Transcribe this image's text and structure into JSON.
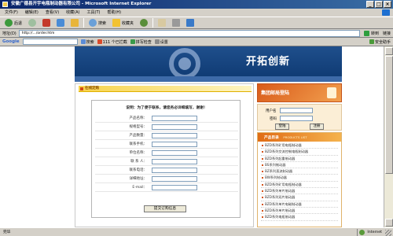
{
  "window": {
    "title": "安徽广德县开宇电瓶制动器有限公司 - Microsoft Internet Explorer"
  },
  "menu": [
    "文件(F)",
    "编辑(E)",
    "查看(V)",
    "收藏(A)",
    "工具(T)",
    "帮助(H)"
  ],
  "toolbar": {
    "back": "后退",
    "search": "搜索",
    "favorites": "收藏夹"
  },
  "address": {
    "label": "地址(D)",
    "value": "http://.../order.htm",
    "go": "转到",
    "links": "链接"
  },
  "googlebar": {
    "logo": "Google",
    "go": "搜索",
    "blocked": "111 个已拦截",
    "spell": "拼写检查",
    "options": "设置",
    "security": "安全助手"
  },
  "banner": {
    "slogan": "开拓创新"
  },
  "order": {
    "section_title": "在线定购",
    "note": "说明：为了便于联系，请您务必详细填写，谢谢！",
    "fields": [
      "产品名称：",
      "规格型号：",
      "产品数量：",
      "联系手机：",
      "单位名称：",
      "联 系 人：",
      "联系电话：",
      "详细地址：",
      "E-mail："
    ],
    "submit": "提交订购信息"
  },
  "sidebar": {
    "mail_title": "集团邮局登陆",
    "user_label": "用户名",
    "pass_label": "密码",
    "login": "登陆",
    "register": "注册",
    "products_title": "产品目录",
    "products_sub": "PRODUCTS LIST",
    "products": [
      "BZD系列矿用电瓶制动器",
      "BZD系列交流控制电瓶制动器",
      "BZD系列起重制动器",
      "BS系列制动器",
      "BZ系列直流制动器",
      "BW系列制动器",
      "BZD系列矿用电瓶制动器",
      "BZD系列单片制动器",
      "BZD系列双片制动器",
      "BZD系列单片电磁制动器",
      "BZD系列单片制动器",
      "BZD系列电瓶制动器"
    ]
  },
  "status": {
    "text": "完毕",
    "zone": "Internet"
  }
}
